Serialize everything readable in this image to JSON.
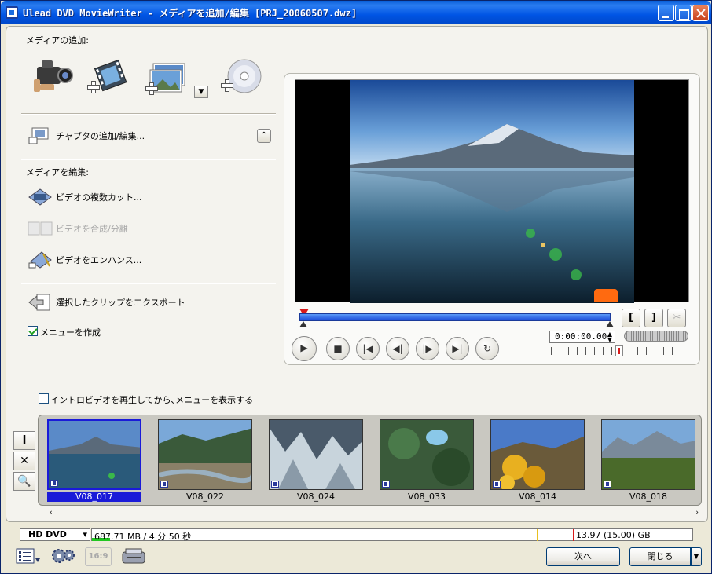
{
  "window": {
    "title": "Ulead DVD MovieWriter - メディアを追加/編集 [PRJ_20060507.dwz]"
  },
  "add_media": {
    "label": "メディアの追加:",
    "icons": [
      "camcorder-icon",
      "add-video-icon",
      "add-image-icon",
      "add-disc-icon"
    ]
  },
  "chapters": {
    "label": "チャプタの追加/編集..."
  },
  "edit_media": {
    "label": "メディアを編集:",
    "multi_trim": "ビデオの複数カット...",
    "merge_split": "ビデオを合成/分離",
    "enhance": "ビデオをエンハンス..."
  },
  "export": {
    "label": "選択したクリップをエクスポート"
  },
  "create_menu": {
    "label": "メニューを作成",
    "checked": true
  },
  "intro": {
    "label": "イントロビデオを再生してから､メニューを表示する",
    "checked": false
  },
  "player": {
    "timecode": "0:00:00.00",
    "mark_in": "[",
    "mark_out": "]",
    "scissors": "✂",
    "controls": [
      "▶",
      "■",
      "|◀",
      "◀|",
      "|▶",
      "▶|",
      "↻"
    ]
  },
  "side_tools": [
    "i",
    "✕",
    "🔍"
  ],
  "clips": [
    {
      "name": "V08_017",
      "selected": true
    },
    {
      "name": "V08_022",
      "selected": false
    },
    {
      "name": "V08_024",
      "selected": false
    },
    {
      "name": "V08_033",
      "selected": false
    },
    {
      "name": "V08_014",
      "selected": false
    },
    {
      "name": "V08_018",
      "selected": false
    }
  ],
  "status": {
    "disc_type": "HD DVD",
    "used": "687.71 MB / 4 分 50 秒",
    "capacity": "13.97 (15.00) GB",
    "used_fraction": 0.03
  },
  "footer": {
    "aspect_label": "16:9",
    "next_button": "次へ",
    "close_button": "閉じる"
  },
  "colors": {
    "selection": "#1a1ad8",
    "capacity_fill": "#21c721",
    "timeline": "#1a4ad8"
  }
}
